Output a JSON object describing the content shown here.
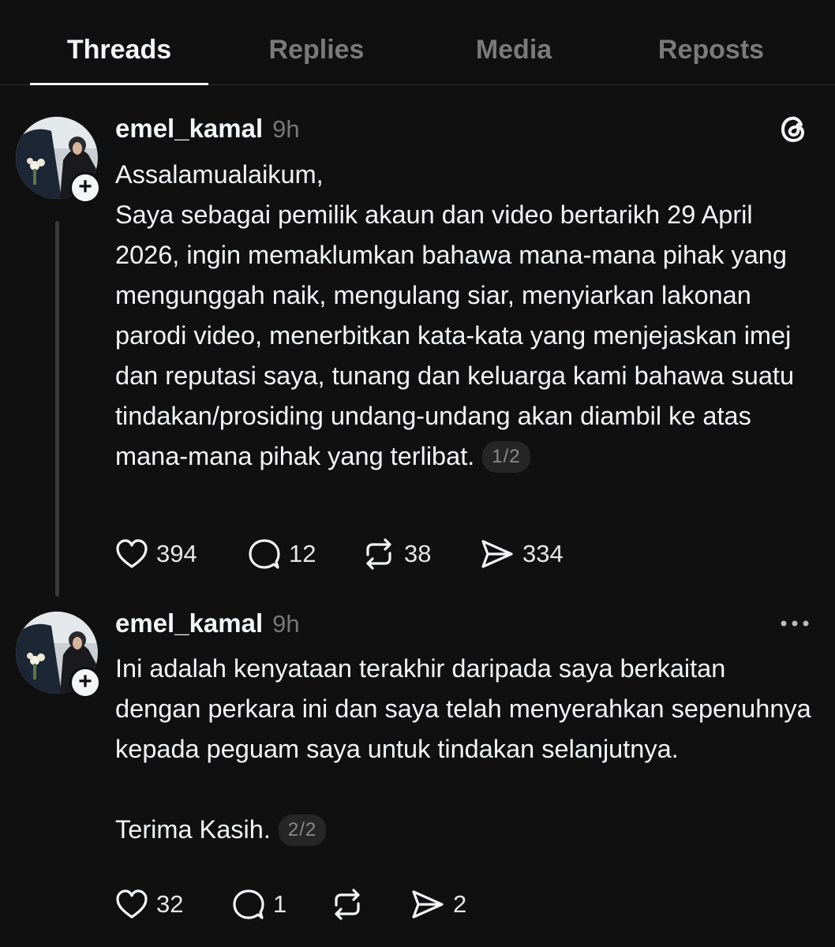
{
  "tabs": [
    {
      "label": "Threads",
      "active": true
    },
    {
      "label": "Replies",
      "active": false
    },
    {
      "label": "Media",
      "active": false
    },
    {
      "label": "Reposts",
      "active": false
    }
  ],
  "posts": [
    {
      "username": "emel_kamal",
      "time": "9h",
      "text": "Assalamualaikum,\nSaya sebagai pemilik akaun dan video bertarikh 29 April 2026, ingin memaklumkan bahawa mana-mana pihak yang mengunggah naik, mengulang siar, menyiarkan lakonan parodi video, menerbitkan kata-kata yang menjejaskan imej dan reputasi saya, tunang dan keluarga kami bahawa suatu tindakan/prosiding undang-undang akan diambil ke atas mana-mana pihak yang terlibat.",
      "page": "1/2",
      "likes": "394",
      "replies": "12",
      "reposts": "38",
      "shares": "334",
      "top_icon": "threads-logo-icon"
    },
    {
      "username": "emel_kamal",
      "time": "9h",
      "text": "Ini adalah kenyataan terakhir daripada saya berkaitan dengan perkara ini dan saya telah menyerahkan sepenuhnya kepada peguam saya untuk tindakan selanjutnya.\n\nTerima Kasih.",
      "page": "2/2",
      "likes": "32",
      "replies": "1",
      "reposts": "",
      "shares": "2",
      "top_icon": "more-options-icon"
    }
  ],
  "colors": {
    "background": "#101010",
    "text": "#f3f5f7",
    "muted": "#777777",
    "divider": "#2e2e2e"
  }
}
